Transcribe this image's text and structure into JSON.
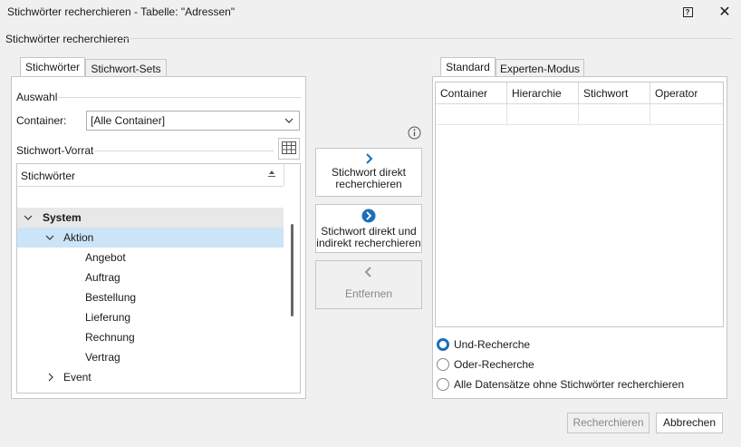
{
  "window": {
    "title": "Stichwörter recherchieren - Tabelle: \"Adressen\"",
    "help_glyph": "?",
    "close_glyph": "✕"
  },
  "section": {
    "title": "Stichwörter recherchieren"
  },
  "left": {
    "tabs": [
      "Stichwörter",
      "Stichwort-Sets"
    ],
    "auswahl_label": "Auswahl",
    "container_label": "Container:",
    "container_value": "[Alle Container]",
    "vorrat_label": "Stichwort-Vorrat",
    "tree_header": "Stichwörter",
    "tree": [
      {
        "label": "System",
        "toggle": "expanded",
        "level": 0
      },
      {
        "label": "Aktion",
        "toggle": "expanded",
        "level": 1
      },
      {
        "label": "Angebot",
        "level": 2
      },
      {
        "label": "Auftrag",
        "level": 2
      },
      {
        "label": "Bestellung",
        "level": 2
      },
      {
        "label": "Lieferung",
        "level": 2
      },
      {
        "label": "Rechnung",
        "level": 2
      },
      {
        "label": "Vertrag",
        "level": 2
      },
      {
        "label": "Event",
        "toggle": "collapsed",
        "level": 1
      }
    ]
  },
  "middle": {
    "info_icon": "info-icon",
    "btn_direct_1": "Stichwort direkt",
    "btn_direct_2": "recherchieren",
    "btn_indirect_1": "Stichwort direkt und",
    "btn_indirect_2": "indirekt recherchieren",
    "btn_remove": "Entfernen"
  },
  "right": {
    "tabs": [
      "Standard",
      "Experten-Modus"
    ],
    "columns": [
      "Container",
      "Hierarchie",
      "Stichwort",
      "Operator"
    ],
    "radios": [
      {
        "label": "Und-Recherche",
        "checked": true
      },
      {
        "label": "Oder-Recherche",
        "checked": false
      },
      {
        "label": "Alle Datensätze ohne Stichwörter recherchieren",
        "checked": false
      }
    ]
  },
  "footer": {
    "search_label": "Recherchieren",
    "cancel_label": "Abbrechen"
  },
  "colors": {
    "accent": "#1a6fb8",
    "selection": "#cce4f7"
  }
}
